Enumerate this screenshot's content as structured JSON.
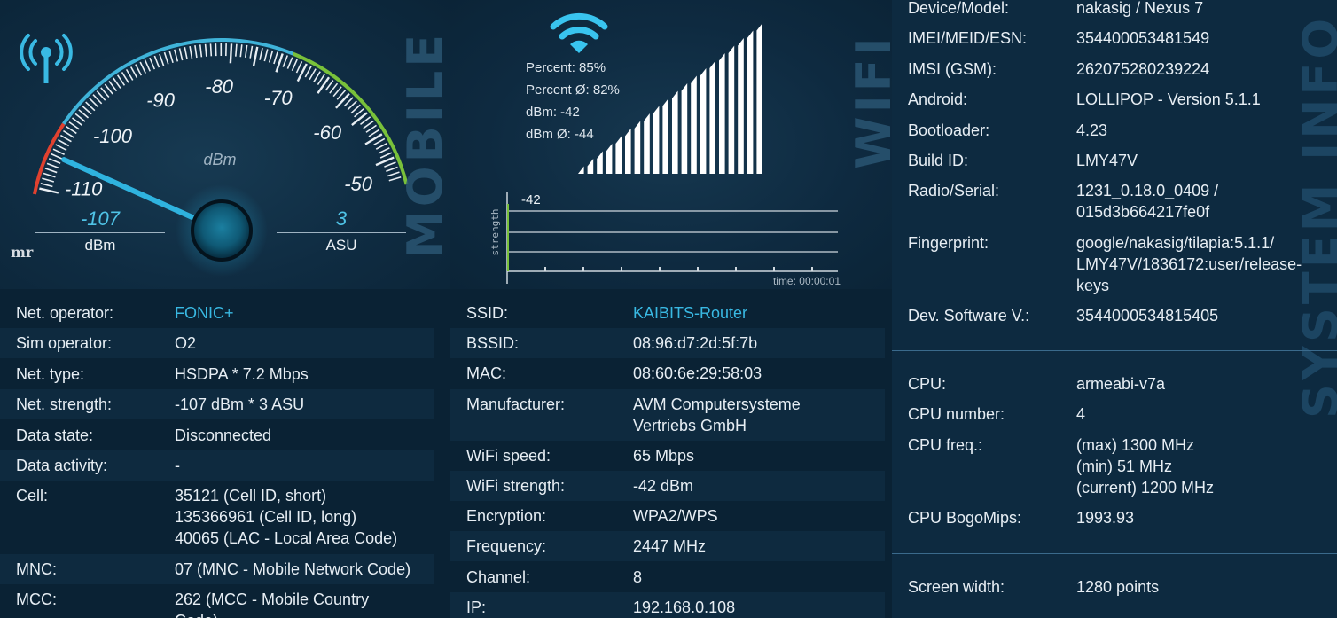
{
  "mobile": {
    "title": "MOBILE",
    "gauge": {
      "ticks": [
        "-110",
        "-100",
        "-90",
        "-80",
        "-70",
        "-60",
        "-50"
      ],
      "unit_label": "dBm",
      "value_dbm": -107
    },
    "dbm_value": "-107",
    "dbm_label": "dBm",
    "asu_value": "3",
    "asu_label": "ASU",
    "watermark": "mr",
    "rows": [
      {
        "label": "Net. operator:",
        "value": [
          "FONIC+"
        ],
        "link": true
      },
      {
        "label": "Sim operator:",
        "value": [
          "O2"
        ]
      },
      {
        "label": "Net. type:",
        "value": [
          "HSDPA * 7.2 Mbps"
        ]
      },
      {
        "label": "Net. strength:",
        "value": [
          "-107 dBm * 3 ASU"
        ]
      },
      {
        "label": "Data state:",
        "value": [
          "Disconnected"
        ]
      },
      {
        "label": "Data activity:",
        "value": [
          "-"
        ]
      },
      {
        "label": "Cell:",
        "value": [
          "35121 (Cell ID, short)",
          "135366961 (Cell ID, long)",
          "40065 (LAC - Local Area Code)"
        ]
      },
      {
        "label": "MNC:",
        "value": [
          "07 (MNC - Mobile Network Code)"
        ]
      },
      {
        "label": "MCC:",
        "value": [
          "262 (MCC - Mobile Country",
          "Code)"
        ]
      }
    ]
  },
  "wifi": {
    "title": "WIFI",
    "stats": [
      "Percent: 85%",
      "Percent Ø: 82%",
      "dBm: -42",
      "dBm Ø: -44"
    ],
    "signal_percent": 85,
    "graph": {
      "y_label": "strength",
      "current_label": "-42",
      "time_label": "time: 00:00:01"
    },
    "rows": [
      {
        "label": "SSID:",
        "value": [
          "KAIBITS-Router"
        ],
        "link": true
      },
      {
        "label": "BSSID:",
        "value": [
          "08:96:d7:2d:5f:7b"
        ]
      },
      {
        "label": "MAC:",
        "value": [
          "08:60:6e:29:58:03"
        ]
      },
      {
        "label": "Manufacturer:",
        "value": [
          "AVM Computersysteme",
          "Vertriebs GmbH"
        ]
      },
      {
        "label": "WiFi speed:",
        "value": [
          "65 Mbps"
        ]
      },
      {
        "label": "WiFi strength:",
        "value": [
          "-42 dBm"
        ]
      },
      {
        "label": "Encryption:",
        "value": [
          "WPA2/WPS"
        ]
      },
      {
        "label": "Frequency:",
        "value": [
          "2447 MHz"
        ]
      },
      {
        "label": "Channel:",
        "value": [
          "8"
        ]
      },
      {
        "label": "IP:",
        "value": [
          "192.168.0.108"
        ]
      }
    ]
  },
  "system": {
    "title": "SYSTEM INFO",
    "device_rows": [
      {
        "label": "Device/Model:",
        "value": [
          "nakasig / Nexus 7"
        ]
      },
      {
        "label": "IMEI/MEID/ESN:",
        "value": [
          "354400053481549"
        ]
      },
      {
        "label": "IMSI (GSM):",
        "value": [
          "262075280239224"
        ]
      },
      {
        "label": "Android:",
        "value": [
          "LOLLIPOP - Version 5.1.1"
        ]
      },
      {
        "label": "Bootloader:",
        "value": [
          "4.23"
        ]
      },
      {
        "label": "Build ID:",
        "value": [
          "LMY47V"
        ]
      },
      {
        "label": "Radio/Serial:",
        "value": [
          "1231_0.18.0_0409 /",
          "015d3b664217fe0f"
        ]
      },
      {
        "label": "Fingerprint:",
        "value": [
          "google/nakasig/tilapia:5.1.1/",
          "LMY47V/1836172:user/release-",
          "keys"
        ]
      },
      {
        "label": "Dev. Software V.:",
        "value": [
          "3544000534815405"
        ]
      }
    ],
    "cpu_rows": [
      {
        "label": "CPU:",
        "value": [
          "armeabi-v7a"
        ]
      },
      {
        "label": "CPU number:",
        "value": [
          "4"
        ]
      },
      {
        "label": "CPU freq.:",
        "value": [
          "(max) 1300 MHz",
          "(min) 51 MHz",
          "(current) 1200 MHz"
        ]
      },
      {
        "label": "CPU BogoMips:",
        "value": [
          "1993.93"
        ]
      }
    ],
    "screen_rows": [
      {
        "label": "Screen width:",
        "value": [
          "1280 points"
        ]
      }
    ]
  },
  "colors": {
    "accent": "#39b9e3",
    "background": "#0b2437",
    "gauge_red": "#e0412f",
    "gauge_green": "#79c13a"
  },
  "icons": {
    "mobile": "antenna-icon",
    "wifi": "wifi-icon"
  }
}
